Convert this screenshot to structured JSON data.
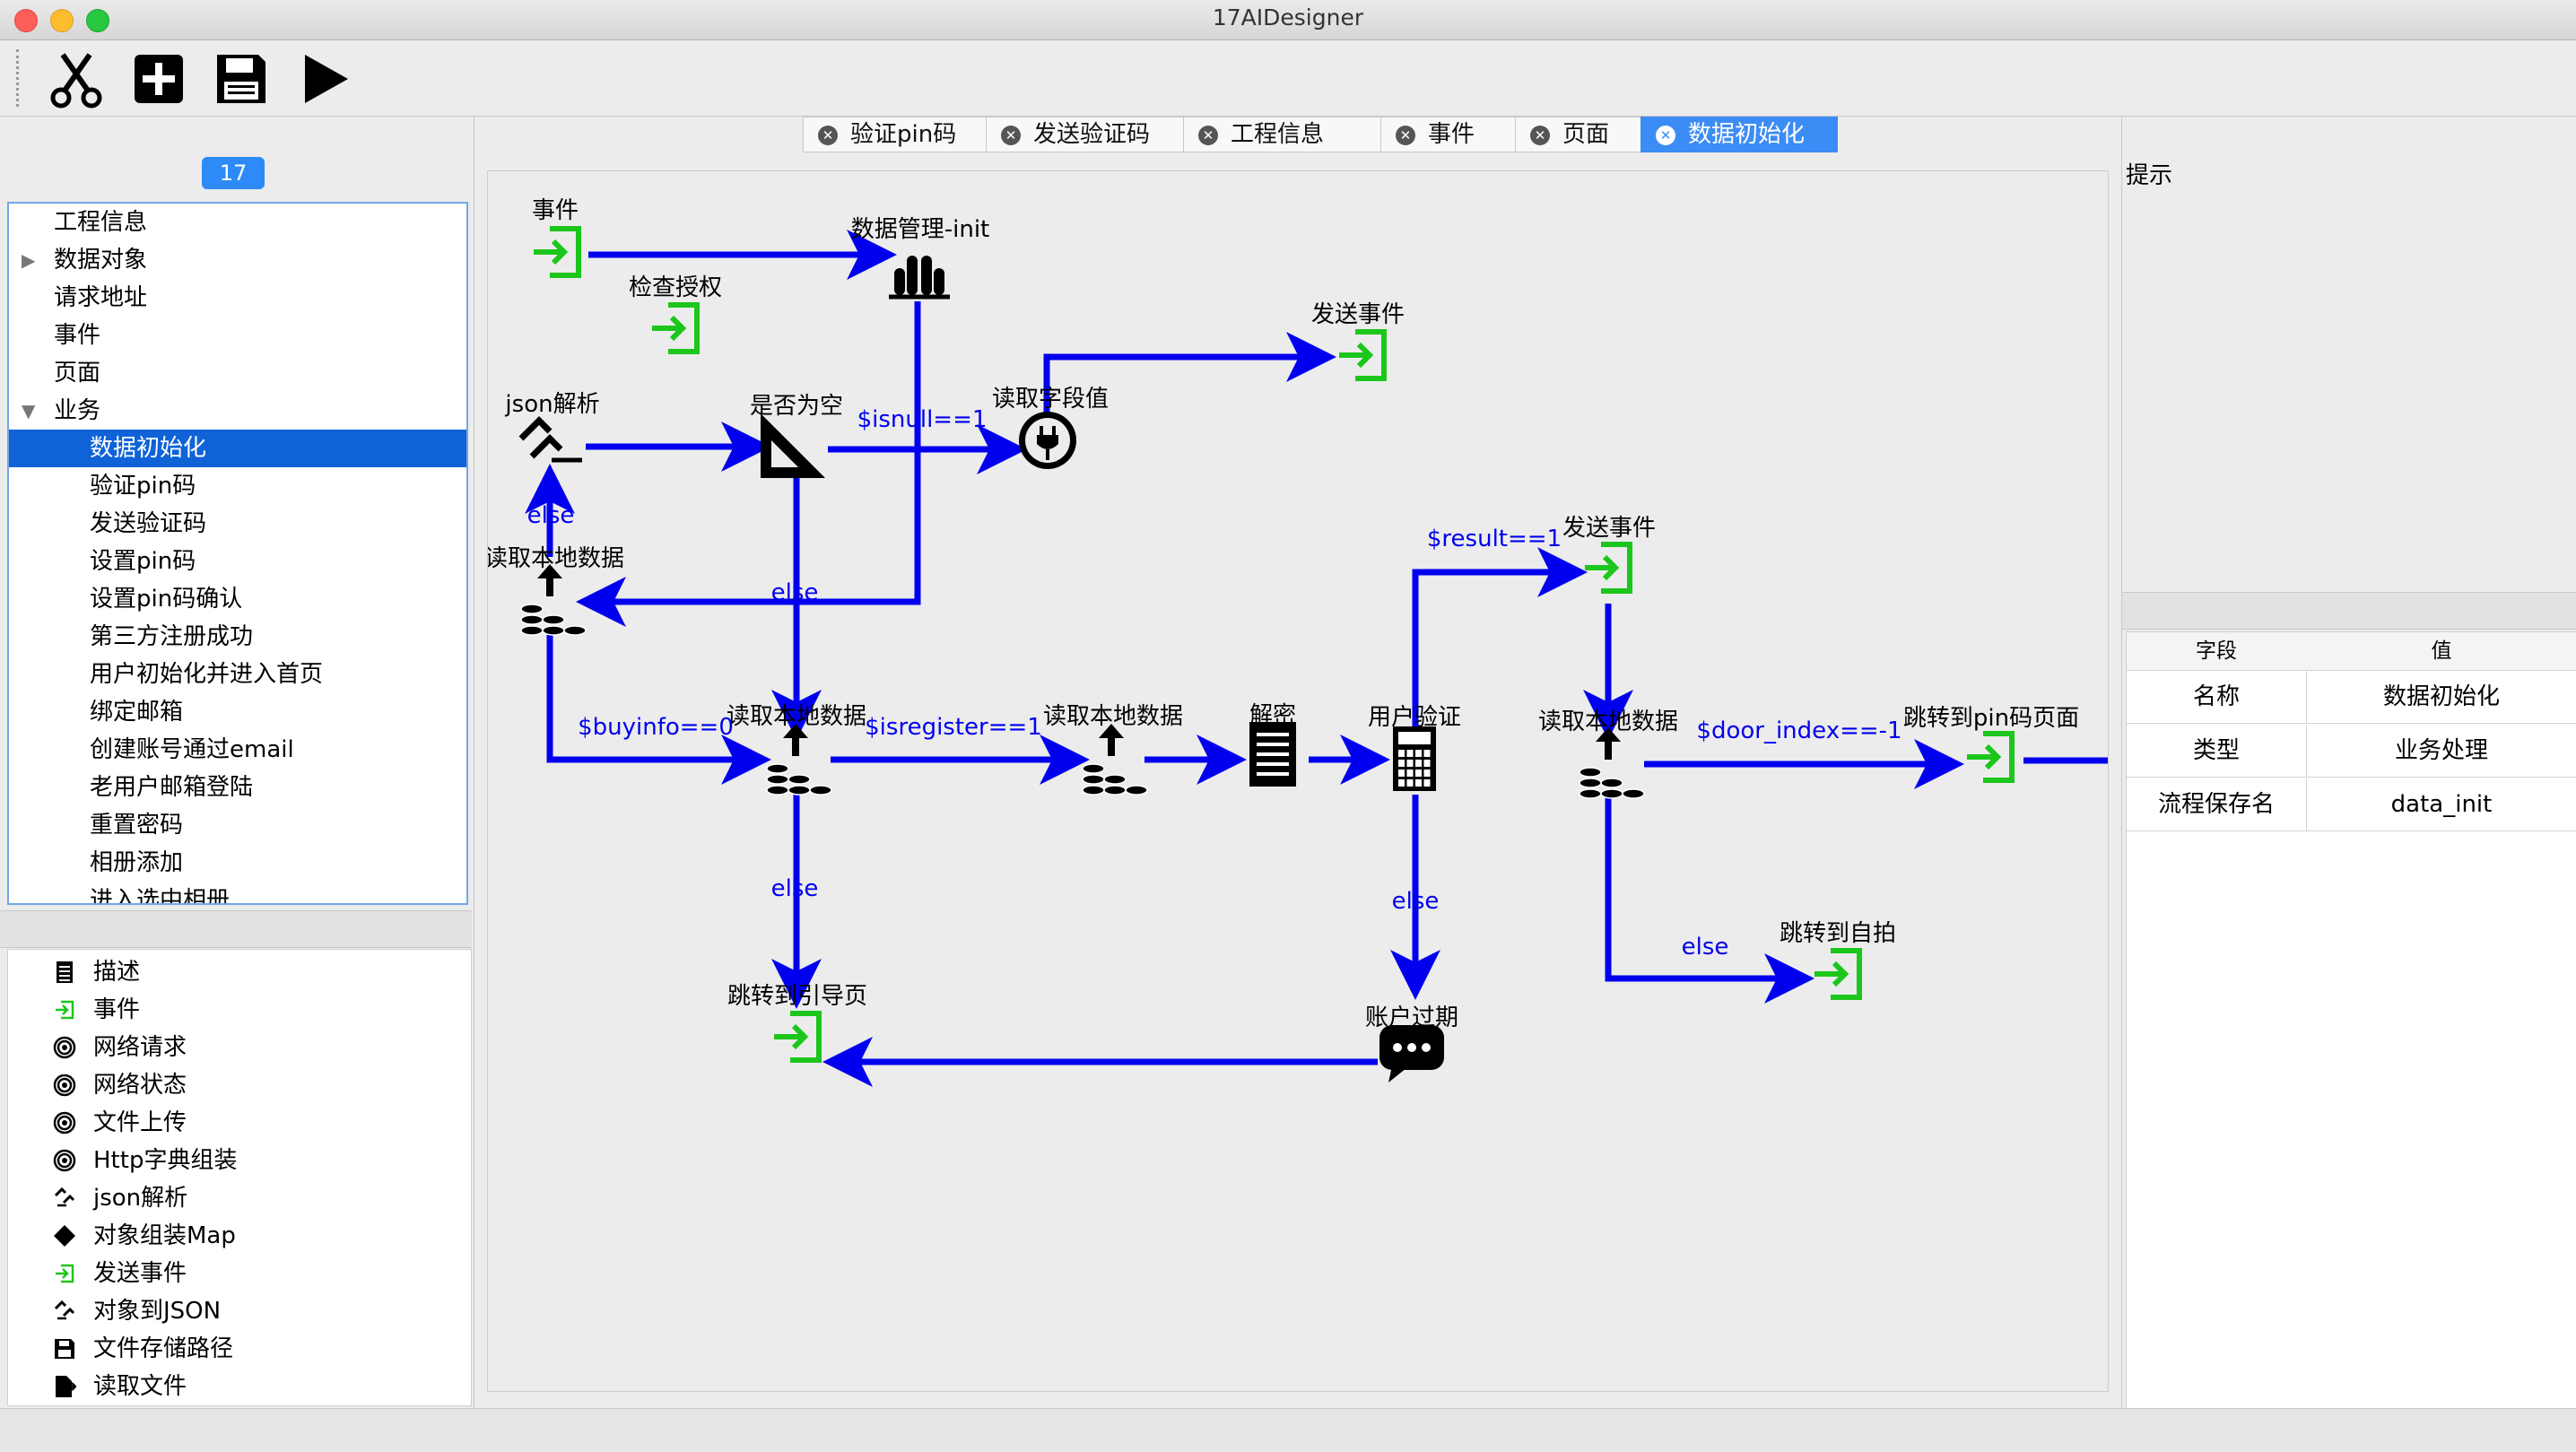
{
  "window": {
    "title": "17AIDesigner"
  },
  "toolbar": {
    "buttons": [
      "cut-icon",
      "add-icon",
      "save-icon",
      "run-icon"
    ]
  },
  "left": {
    "badge": "17",
    "tree": [
      {
        "label": "工程信息",
        "level": 0,
        "arrow": ""
      },
      {
        "label": "数据对象",
        "level": 0,
        "arrow": "▶"
      },
      {
        "label": "请求地址",
        "level": 0,
        "arrow": ""
      },
      {
        "label": "事件",
        "level": 0,
        "arrow": ""
      },
      {
        "label": "页面",
        "level": 0,
        "arrow": ""
      },
      {
        "label": "业务",
        "level": 0,
        "arrow": "▼"
      },
      {
        "label": "数据初始化",
        "level": 1,
        "arrow": "",
        "selected": true
      },
      {
        "label": "验证pin码",
        "level": 1,
        "arrow": ""
      },
      {
        "label": "发送验证码",
        "level": 1,
        "arrow": ""
      },
      {
        "label": "设置pin码",
        "level": 1,
        "arrow": ""
      },
      {
        "label": "设置pin码确认",
        "level": 1,
        "arrow": ""
      },
      {
        "label": "第三方注册成功",
        "level": 1,
        "arrow": ""
      },
      {
        "label": "用户初始化并进入首页",
        "level": 1,
        "arrow": ""
      },
      {
        "label": "绑定邮箱",
        "level": 1,
        "arrow": ""
      },
      {
        "label": "创建账号通过email",
        "level": 1,
        "arrow": ""
      },
      {
        "label": "老用户邮箱登陆",
        "level": 1,
        "arrow": ""
      },
      {
        "label": "重置密码",
        "level": 1,
        "arrow": ""
      },
      {
        "label": "相册添加",
        "level": 1,
        "arrow": ""
      },
      {
        "label": "进入选中相册",
        "level": 1,
        "arrow": ""
      }
    ],
    "palette": [
      {
        "label": "描述",
        "icon": "document-icon"
      },
      {
        "label": "事件",
        "icon": "event-enter-icon"
      },
      {
        "label": "网络请求",
        "icon": "network-icon"
      },
      {
        "label": "网络状态",
        "icon": "network-icon"
      },
      {
        "label": "文件上传",
        "icon": "network-icon"
      },
      {
        "label": "Http字典组装",
        "icon": "network-icon"
      },
      {
        "label": "json解析",
        "icon": "json-icon"
      },
      {
        "label": "对象组装Map",
        "icon": "diamond-icon"
      },
      {
        "label": "发送事件",
        "icon": "event-enter-icon"
      },
      {
        "label": "对象到JSON",
        "icon": "json-icon"
      },
      {
        "label": "文件存储路径",
        "icon": "save-icon"
      },
      {
        "label": "读取文件",
        "icon": "file-read-icon"
      }
    ]
  },
  "tabs": [
    {
      "label": "验证pin码",
      "active": false
    },
    {
      "label": "发送验证码",
      "active": false
    },
    {
      "label": "工程信息",
      "active": false
    },
    {
      "label": "事件",
      "active": false
    },
    {
      "label": "页面",
      "active": false
    },
    {
      "label": "数据初始化",
      "active": true
    }
  ],
  "flow": {
    "nodes": {
      "event": "事件",
      "data_init": "数据管理-init",
      "check_auth": "检查授权",
      "send_event_1": "发送事件",
      "json_parse": "json解析",
      "is_empty": "是否为空",
      "read_field": "读取字段值",
      "read_local_1": "读取本地数据",
      "read_local_2": "读取本地数据",
      "read_local_3": "读取本地数据",
      "decrypt": "解密",
      "user_verify": "用户验证",
      "send_event_2": "发送事件",
      "read_local_4": "读取本地数据",
      "goto_pin": "跳转到pin码页面",
      "goto_guide": "跳转到引导页",
      "account_expired": "账户过期",
      "goto_selfie": "跳转到自拍"
    },
    "edge_labels": {
      "isnull": "$isnull==1",
      "else": "else",
      "buyinfo": "$buyinfo==0",
      "isregister": "$isregister==1",
      "result": "$result==1",
      "door_index": "$door_index==-1"
    },
    "edge_color": "#0000ee",
    "event_color": "#1cc61c"
  },
  "right": {
    "hint": "提示",
    "table": {
      "headers": [
        "字段",
        "值"
      ],
      "rows": [
        [
          "名称",
          "数据初始化"
        ],
        [
          "类型",
          "业务处理"
        ],
        [
          "流程保存名",
          "data_init"
        ]
      ]
    }
  }
}
